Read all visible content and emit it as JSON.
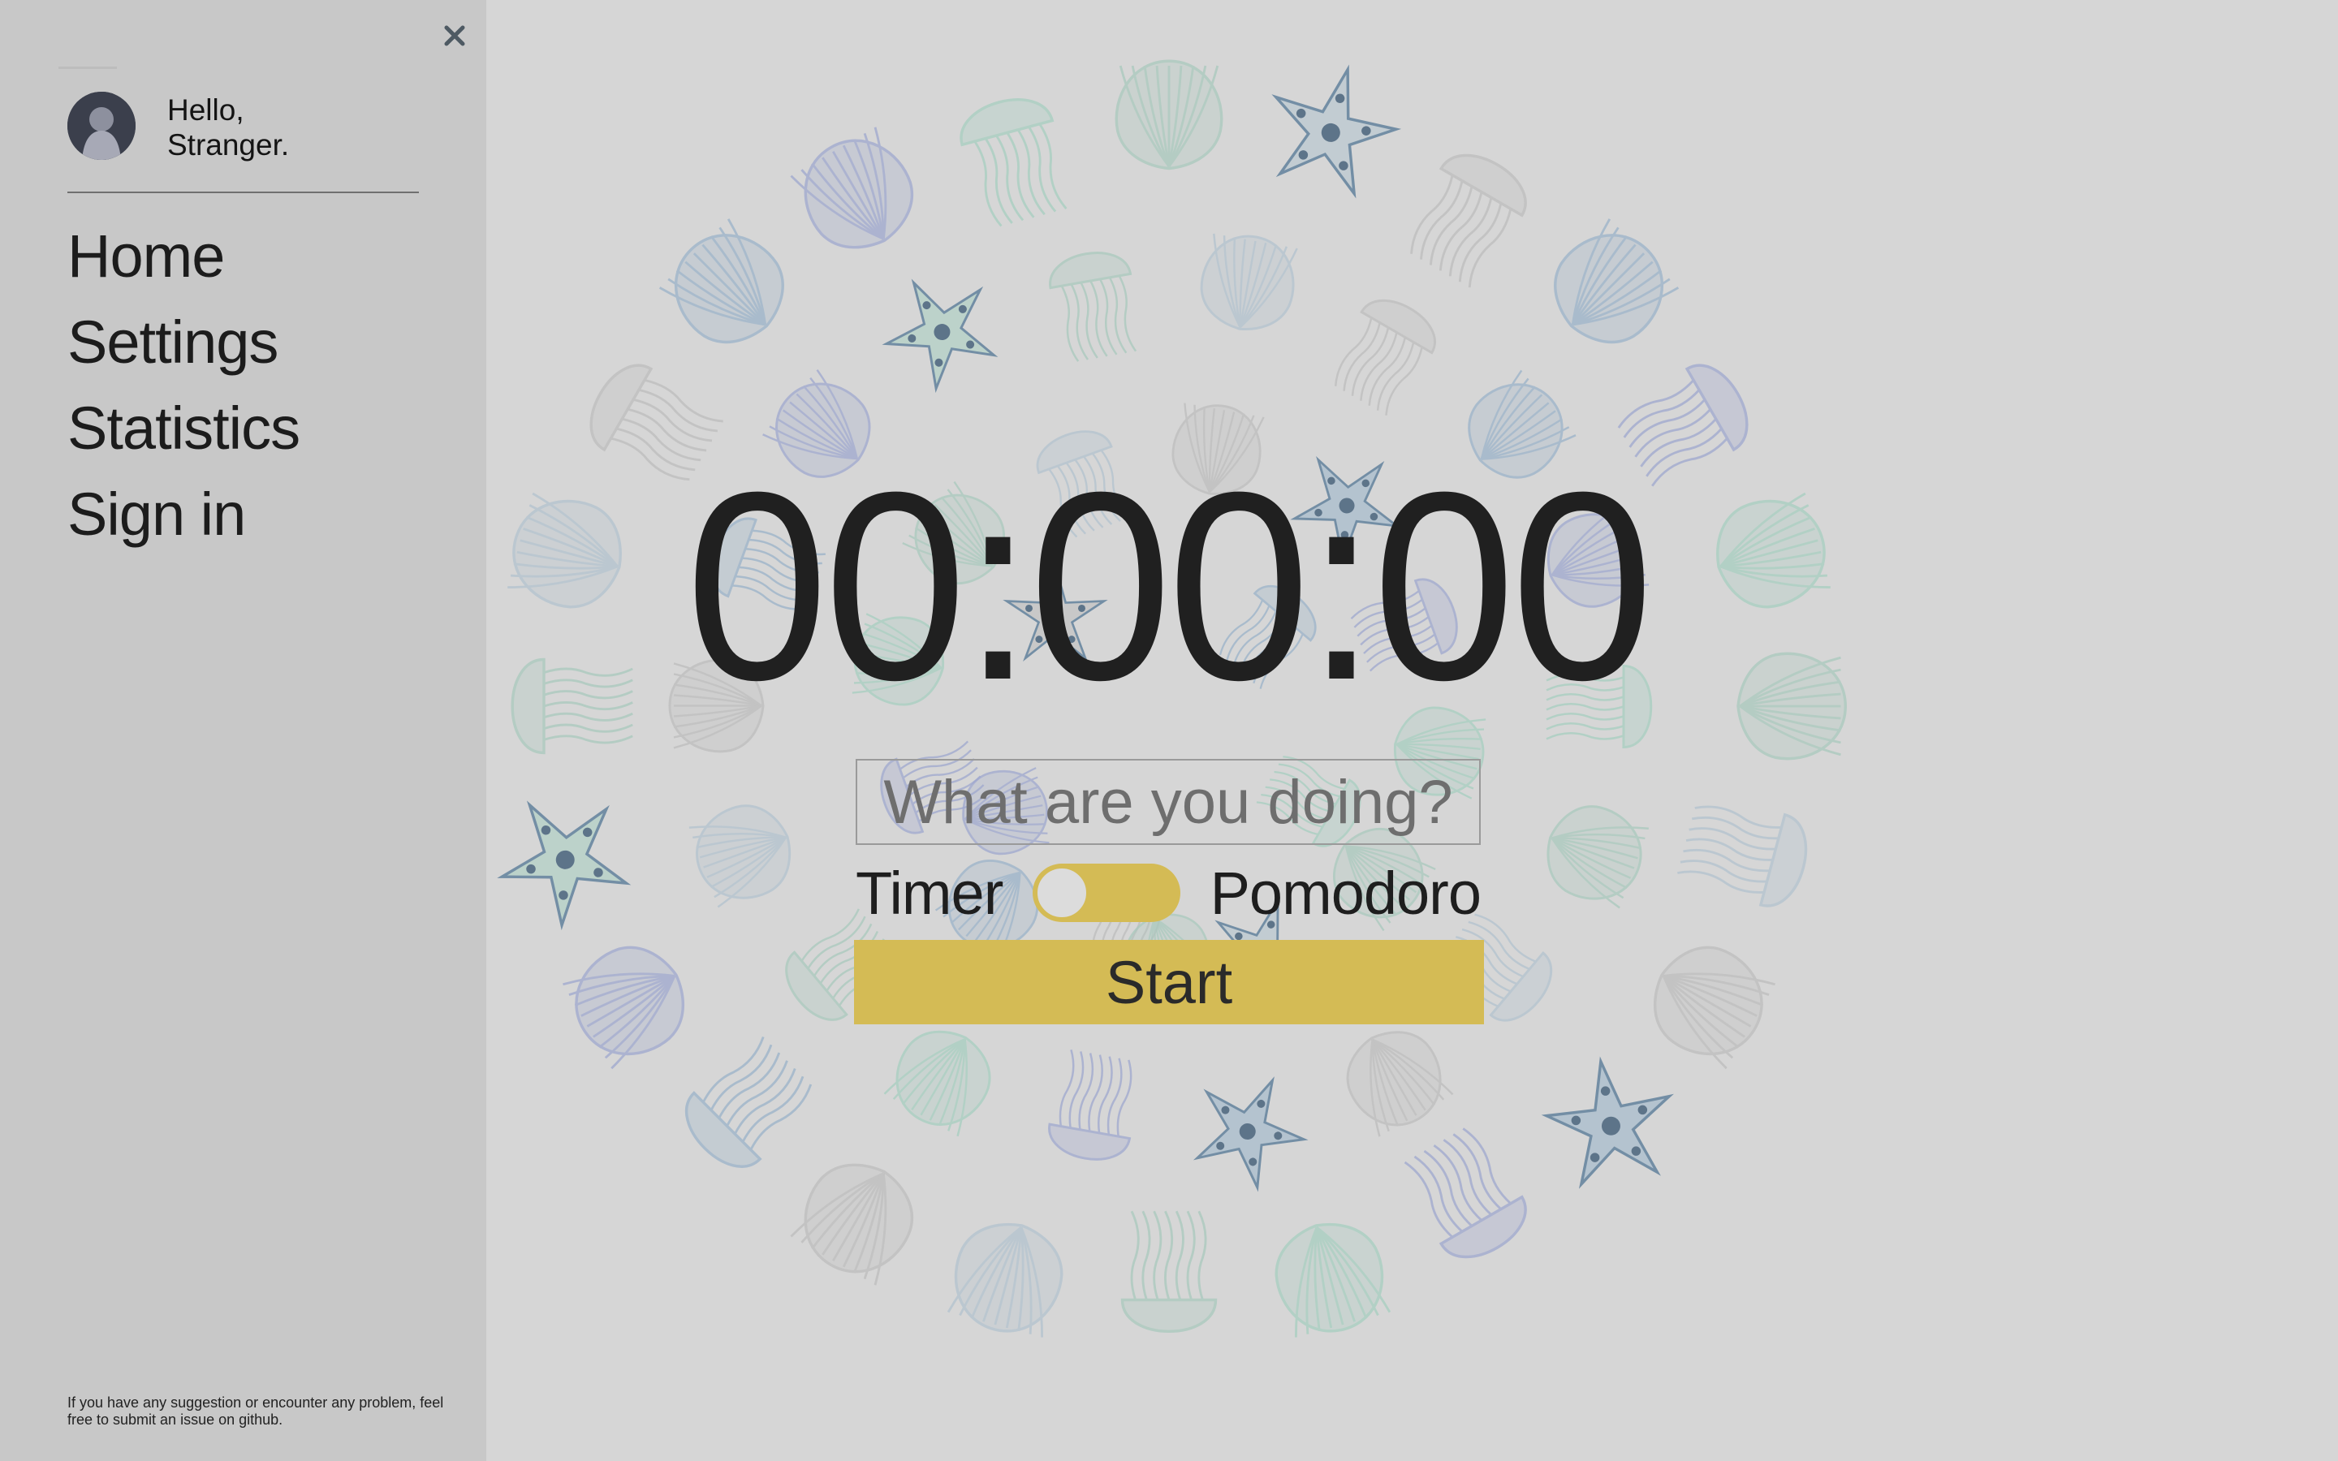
{
  "sidebar": {
    "greeting_line1": "Hello,",
    "greeting_line2": "Stranger.",
    "nav": [
      "Home",
      "Settings",
      "Statistics",
      "Sign in"
    ],
    "footer_note": "If you have any suggestion or encounter any problem, feel free to submit an issue on github.",
    "close_icon": "close-icon",
    "avatar_icon": "user-avatar-icon"
  },
  "main": {
    "timer": "00:00:00",
    "task_placeholder": "What are you doing?",
    "task_value": "",
    "mode_left": "Timer",
    "mode_right": "Pomodoro",
    "start_label": "Start",
    "toggle_state": "Timer"
  },
  "colors": {
    "accent": "#d4bb55",
    "background": "#d6d6d6",
    "sidebar": "#c8c8c8",
    "text": "#202020"
  }
}
